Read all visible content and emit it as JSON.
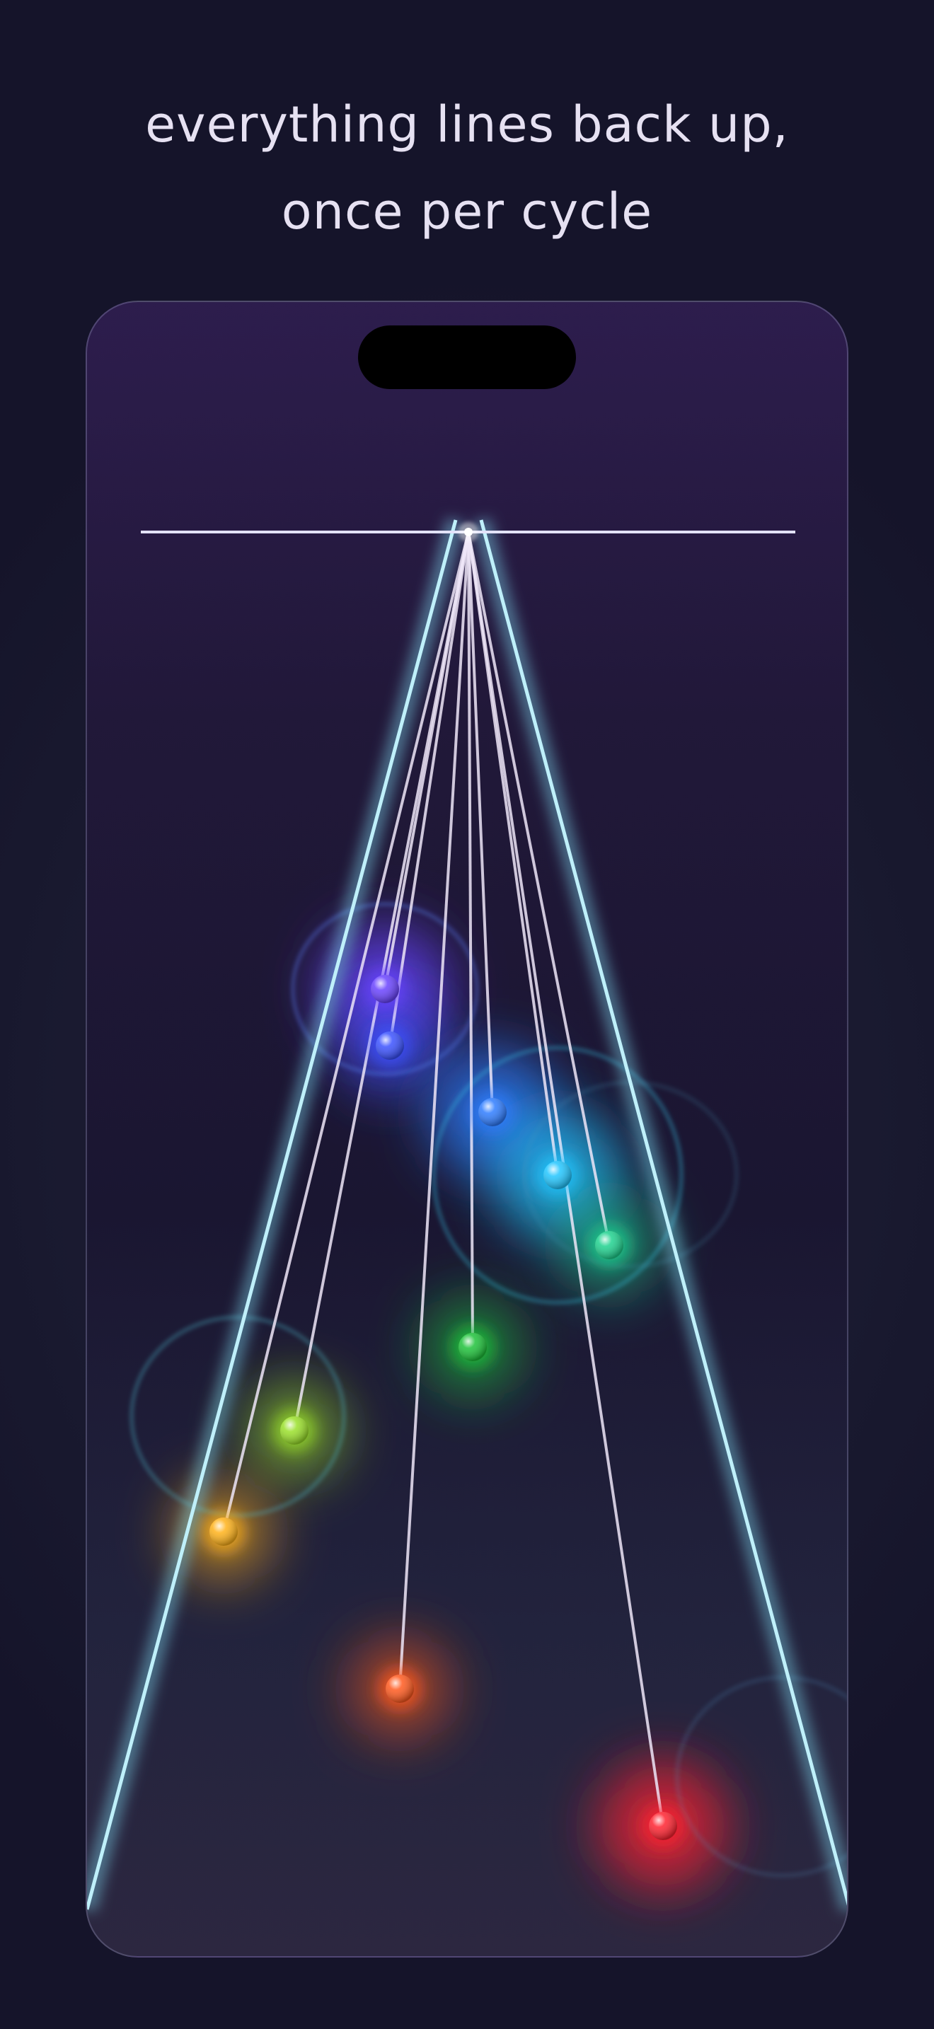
{
  "headline": {
    "line1": "everything lines back up,",
    "line2": "once per cycle"
  },
  "colors": {
    "background": "#16152a",
    "headline_text": "#e6e1f2",
    "track": "#dcdcf5",
    "string": "#efe6f8",
    "beam": "#8fe0f0"
  },
  "pendulums": [
    {
      "name": "violet",
      "color": "#6a43ff"
    },
    {
      "name": "indigo",
      "color": "#3b52ff"
    },
    {
      "name": "blue",
      "color": "#2f7dff"
    },
    {
      "name": "cyan",
      "color": "#22c6ff"
    },
    {
      "name": "teal",
      "color": "#1fd28f"
    },
    {
      "name": "green",
      "color": "#1ec23a"
    },
    {
      "name": "lime",
      "color": "#9ae02a"
    },
    {
      "name": "amber",
      "color": "#ffb21a"
    },
    {
      "name": "orange",
      "color": "#ff5a1f"
    },
    {
      "name": "red",
      "color": "#ff2330"
    }
  ]
}
